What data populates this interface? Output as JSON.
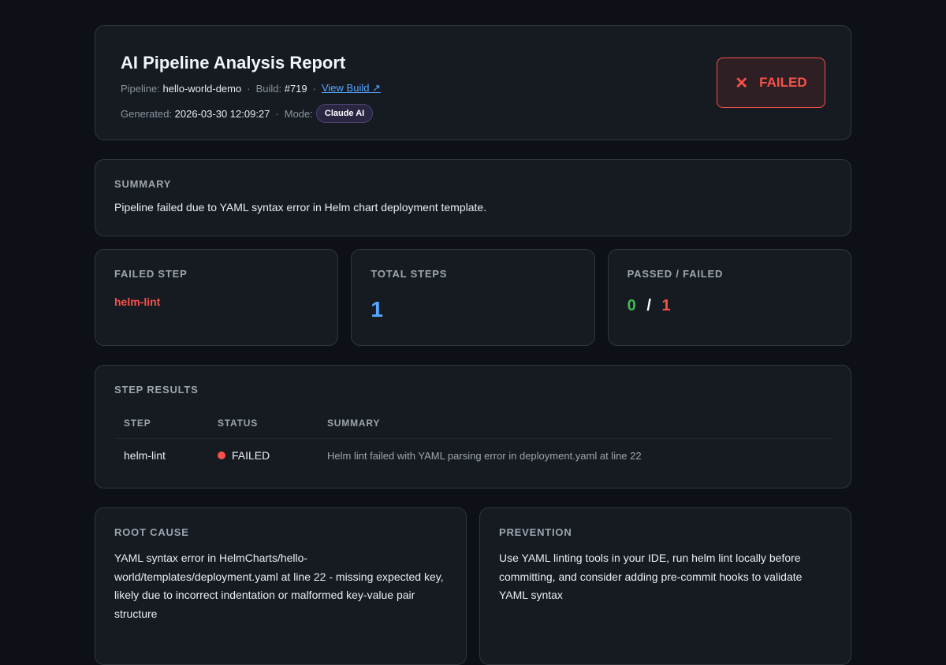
{
  "header": {
    "title": "AI Pipeline Analysis Report",
    "pipeline_label": "Pipeline:",
    "pipeline": "hello-world-demo",
    "build_label": "Build:",
    "build": "#719",
    "view_build": "View Build ↗",
    "generated_label": "Generated:",
    "generated": "2026-03-30 12:09:27",
    "mode_label": "Mode:",
    "mode": "Claude AI",
    "sep": "·",
    "status": "FAILED",
    "status_icon": "✕"
  },
  "summary": {
    "title": "SUMMARY",
    "text": "Pipeline failed due to YAML syntax error in Helm chart deployment template."
  },
  "stats": {
    "failed_step_label": "FAILED STEP",
    "failed_step": "helm-lint",
    "total_label": "TOTAL STEPS",
    "total": "1",
    "pf_label": "PASSED / FAILED",
    "passed": "0",
    "slash": "/",
    "failed": "1"
  },
  "steps": {
    "title": "STEP RESULTS",
    "headers": [
      "STEP",
      "STATUS",
      "SUMMARY"
    ],
    "rows": [
      {
        "step": "helm-lint",
        "status": "FAILED",
        "summary": "Helm lint failed with YAML parsing error in deployment.yaml at line 22"
      }
    ]
  },
  "root_cause": {
    "title": "ROOT CAUSE",
    "text": "YAML syntax error in HelmCharts/hello-world/templates/deployment.yaml at line 22 - missing expected key, likely due to incorrect indentation or malformed key-value pair structure"
  },
  "prevention": {
    "title": "PREVENTION",
    "text": "Use YAML linting tools in your IDE, run helm lint locally before committing, and consider adding pre-commit hooks to validate YAML syntax"
  },
  "colors": {
    "bg": "#0d1117",
    "card": "#161b22",
    "red": "#f85149",
    "green": "#3fb950",
    "blue": "#58a6ff"
  }
}
